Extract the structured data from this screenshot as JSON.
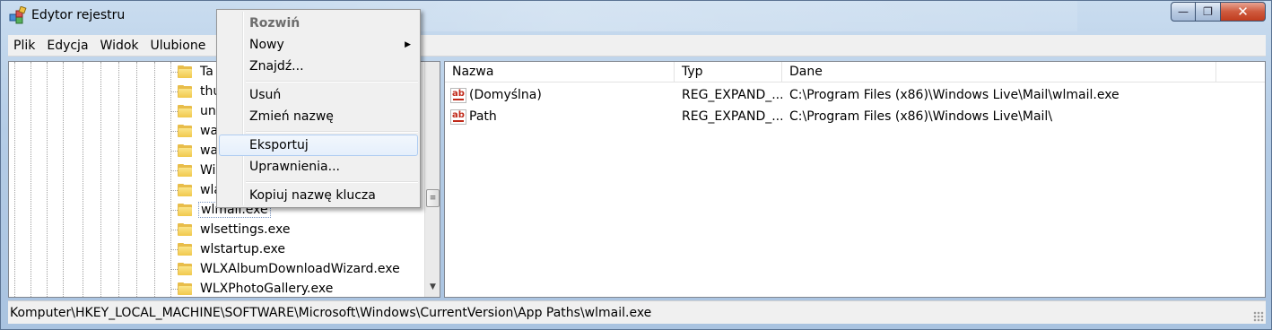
{
  "window": {
    "title": "Edytor rejestru",
    "controls": {
      "minimize": "—",
      "maximize": "❐",
      "close": "✕"
    }
  },
  "menubar": {
    "items": [
      {
        "label": "Plik"
      },
      {
        "label": "Edycja"
      },
      {
        "label": "Widok"
      },
      {
        "label": "Ulubione"
      }
    ]
  },
  "tree": {
    "items": [
      {
        "label": "Ta"
      },
      {
        "label": "thu"
      },
      {
        "label": "unc"
      },
      {
        "label": "wa"
      },
      {
        "label": "wa"
      },
      {
        "label": "Wi"
      },
      {
        "label": "wla"
      },
      {
        "label": "wlmail.exe",
        "selected": true
      },
      {
        "label": "wlsettings.exe"
      },
      {
        "label": "wlstartup.exe"
      },
      {
        "label": "WLXAlbumDownloadWizard.exe"
      },
      {
        "label": "WLXPhotoGallery.exe"
      }
    ]
  },
  "list": {
    "columns": {
      "name": "Nazwa",
      "type": "Typ",
      "data": "Dane"
    },
    "rows": [
      {
        "name": "(Domyślna)",
        "type": "REG_EXPAND_...",
        "data": "C:\\Program Files (x86)\\Windows Live\\Mail\\wlmail.exe",
        "icon": "ab-string-icon"
      },
      {
        "name": "Path",
        "type": "REG_EXPAND_...",
        "data": "C:\\Program Files (x86)\\Windows Live\\Mail\\",
        "icon": "ab-string-icon"
      }
    ]
  },
  "statusbar": {
    "path": "Komputer\\HKEY_LOCAL_MACHINE\\SOFTWARE\\Microsoft\\Windows\\CurrentVersion\\App Paths\\wlmail.exe"
  },
  "context_menu": {
    "expand": "Rozwiń",
    "new": "Nowy",
    "find": "Znajdź...",
    "delete": "Usuń",
    "rename": "Zmień nazwę",
    "export": "Eksportuj",
    "permissions": "Uprawnienia...",
    "copy_key_name": "Kopiuj nazwę klucza"
  }
}
